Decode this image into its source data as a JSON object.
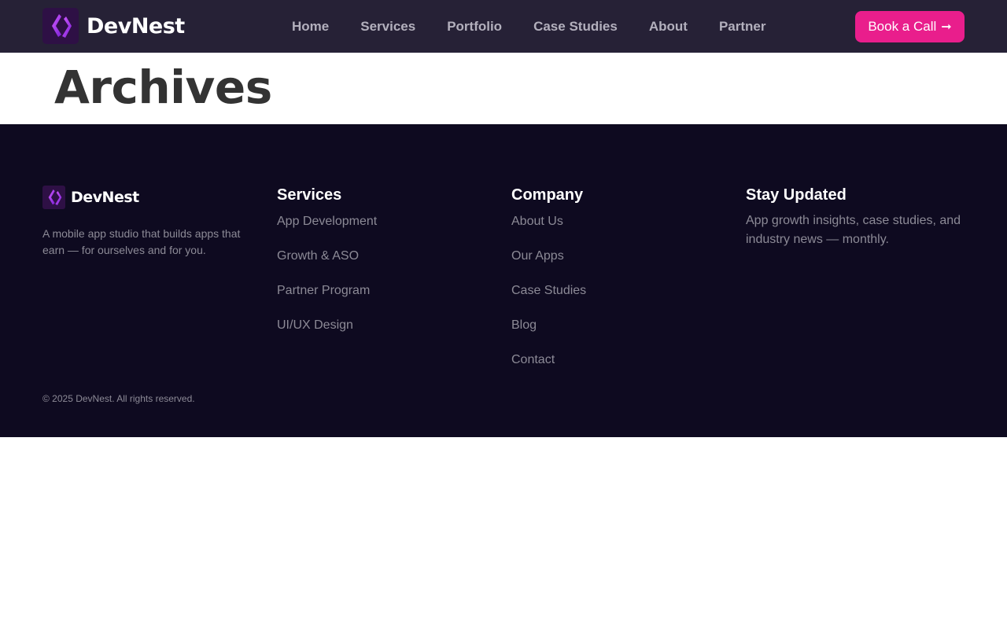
{
  "header": {
    "brand": "DevNest",
    "nav": [
      "Home",
      "Services",
      "Portfolio",
      "Case Studies",
      "About",
      "Partner"
    ],
    "cta_label": "Book a Call",
    "cta_icon": "arrow-right-icon"
  },
  "page": {
    "title": "Archives"
  },
  "footer": {
    "brand": "DevNest",
    "description": "A mobile app studio that builds apps that earn — for ourselves and for you.",
    "services": {
      "heading": "Services",
      "links": [
        "App Development",
        "Growth & ASO",
        "Partner Program",
        "UI/UX Design"
      ]
    },
    "company": {
      "heading": "Company",
      "links": [
        "About Us",
        "Our Apps",
        "Case Studies",
        "Blog",
        "Contact"
      ]
    },
    "newsletter": {
      "heading": "Stay Updated",
      "text": "App growth insights, case studies, and industry news — monthly."
    },
    "copyright": "© 2025 DevNest. All rights reserved."
  },
  "colors": {
    "header_bg": "#262136",
    "accent": "#e91e8c",
    "footer_bg": "#0e0a20",
    "logo_gradient": [
      "#c04dff",
      "#7a1fd6"
    ]
  }
}
